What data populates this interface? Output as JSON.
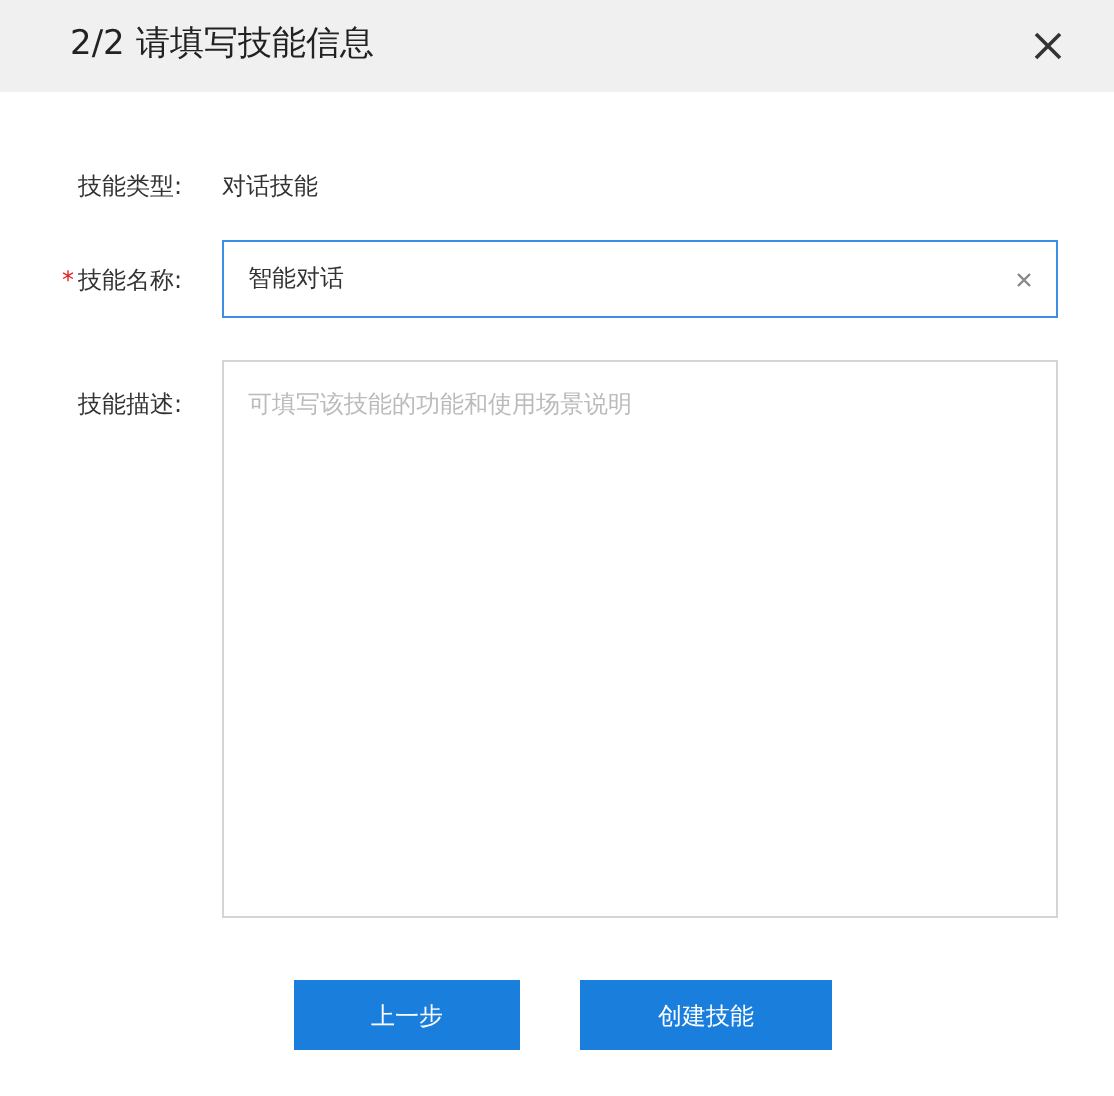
{
  "dialog": {
    "title": "2/2 请填写技能信息"
  },
  "type_row": {
    "label": "技能类型:",
    "value": "对话技能"
  },
  "name_row": {
    "required_mark": "*",
    "label": "技能名称:",
    "value": "智能对话"
  },
  "description_row": {
    "label": "技能描述:",
    "placeholder": "可填写该技能的功能和使用场景说明"
  },
  "buttons": [
    {
      "label": "上一步"
    },
    {
      "label": "创建技能"
    }
  ]
}
